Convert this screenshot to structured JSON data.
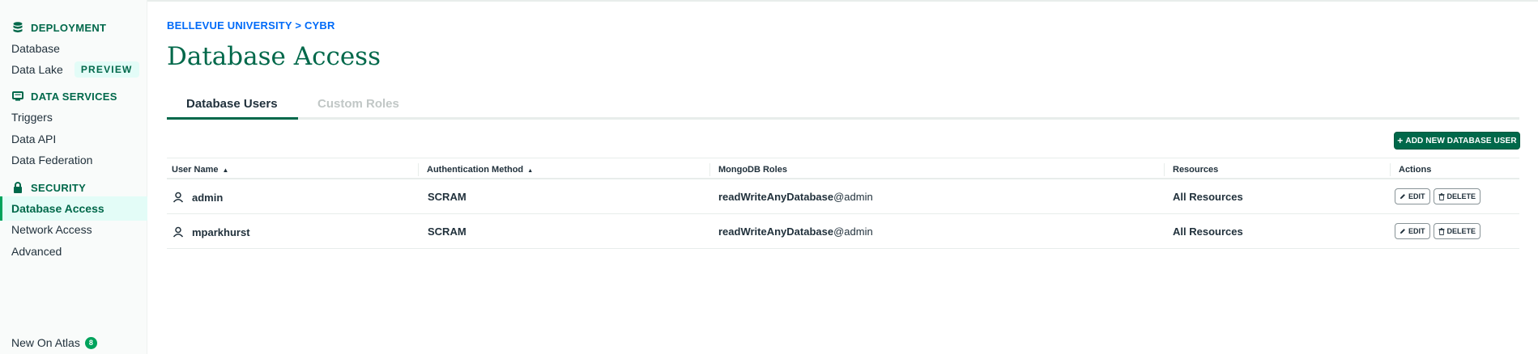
{
  "sidebar": {
    "sections": [
      {
        "label": "DEPLOYMENT",
        "icon": "database-icon"
      },
      {
        "label": "DATA SERVICES",
        "icon": "monitor-icon"
      },
      {
        "label": "SECURITY",
        "icon": "lock-icon"
      }
    ],
    "items": {
      "database": "Database",
      "data_lake": "Data Lake",
      "preview_badge": "PREVIEW",
      "triggers": "Triggers",
      "data_api": "Data API",
      "data_federation": "Data Federation",
      "database_access": "Database Access",
      "network_access": "Network Access",
      "advanced": "Advanced",
      "new_on_atlas": "New On Atlas",
      "new_on_atlas_count": "8"
    },
    "active_item": "Database Access"
  },
  "breadcrumb": "BELLEVUE UNIVERSITY > CYBR",
  "page_title": "Database Access",
  "tabs": [
    {
      "label": "Database Users",
      "active": true
    },
    {
      "label": "Custom Roles",
      "active": false
    }
  ],
  "add_button_label": "ADD NEW DATABASE USER",
  "table": {
    "headers": {
      "user_name": "User Name",
      "auth_method": "Authentication Method",
      "roles": "MongoDB Roles",
      "resources": "Resources",
      "actions": "Actions"
    },
    "rows": [
      {
        "user": "admin",
        "auth": "SCRAM",
        "role": "readWriteAnyDatabase",
        "role_db": "@admin",
        "resources": "All Resources"
      },
      {
        "user": "mparkhurst",
        "auth": "SCRAM",
        "role": "readWriteAnyDatabase",
        "role_db": "@admin",
        "resources": "All Resources"
      }
    ],
    "edit_label": "EDIT",
    "delete_label": "DELETE"
  },
  "colors": {
    "brand_green": "#00684a",
    "accent_green": "#00a35c",
    "active_bg": "#e3fcf7",
    "link_blue": "#016bf8"
  }
}
